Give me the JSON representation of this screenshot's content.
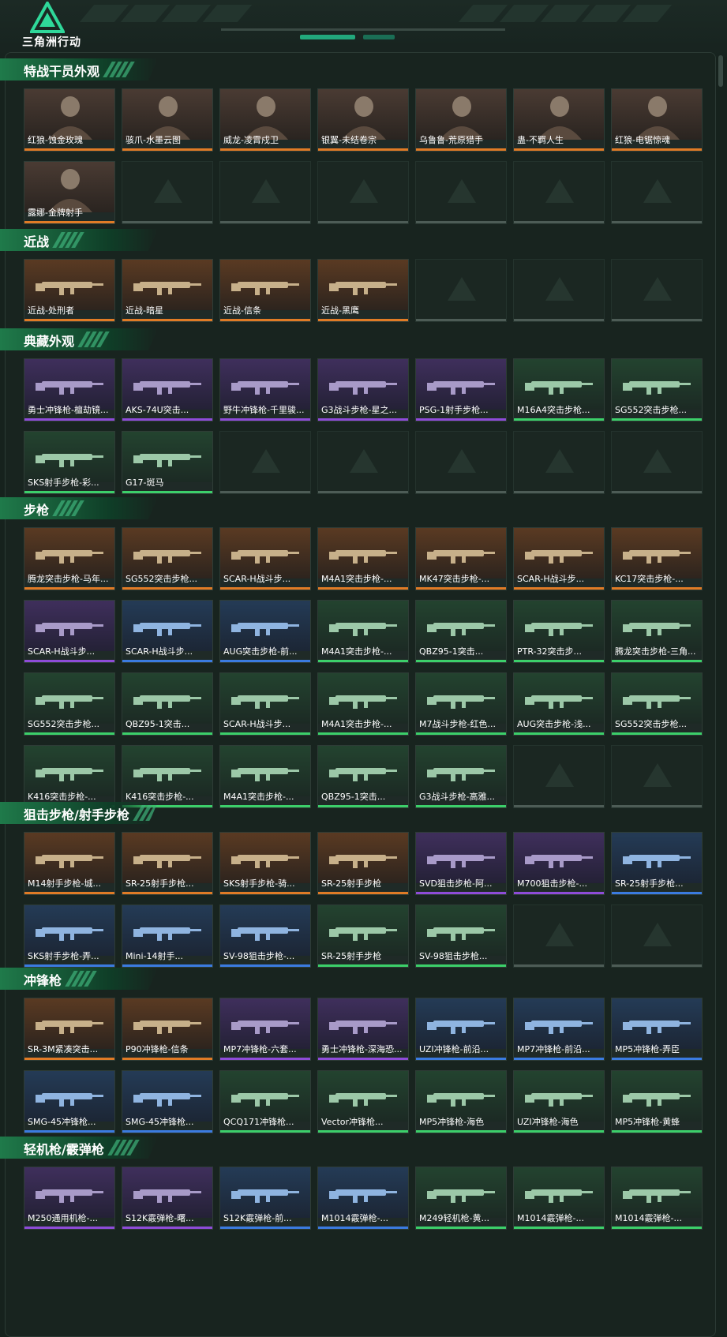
{
  "header": {
    "logo_text": "三角洲行动"
  },
  "sections": [
    {
      "title": "特战干员外观",
      "rows": [
        [
          {
            "label": "红狼-蚀金玫瑰",
            "rarity": "gold"
          },
          {
            "label": "骇爪-水墨云图",
            "rarity": "gold"
          },
          {
            "label": "威龙-凌霄戍卫",
            "rarity": "gold"
          },
          {
            "label": "银翼-未结卷宗",
            "rarity": "gold"
          },
          {
            "label": "乌鲁鲁-荒原猎手",
            "rarity": "gold"
          },
          {
            "label": "蛊-不羁人生",
            "rarity": "gold"
          },
          {
            "label": "红狼-电锯惊魂",
            "rarity": "gold"
          }
        ],
        [
          {
            "label": "露娜-金牌射手",
            "rarity": "gold"
          },
          null,
          null,
          null,
          null,
          null,
          null
        ]
      ]
    },
    {
      "title": "近战",
      "rows": [
        [
          {
            "label": "近战-处刑者",
            "rarity": "gold"
          },
          {
            "label": "近战-暗星",
            "rarity": "gold"
          },
          {
            "label": "近战-信条",
            "rarity": "gold"
          },
          {
            "label": "近战-黑鹰",
            "rarity": "gold"
          },
          null,
          null,
          null
        ]
      ]
    },
    {
      "title": "典藏外观",
      "rows": [
        [
          {
            "label": "勇士冲锋枪-檀劫镜...",
            "rarity": "purple"
          },
          {
            "label": "AKS-74U突击...",
            "rarity": "purple"
          },
          {
            "label": "野牛冲锋枪-千里骏...",
            "rarity": "purple"
          },
          {
            "label": "G3战斗步枪-星之...",
            "rarity": "purple"
          },
          {
            "label": "PSG-1射手步枪...",
            "rarity": "purple"
          },
          {
            "label": "M16A4突击步枪...",
            "rarity": "green"
          },
          {
            "label": "SG552突击步枪...",
            "rarity": "green"
          }
        ],
        [
          {
            "label": "SKS射手步枪-彩...",
            "rarity": "green"
          },
          {
            "label": "G17-斑马",
            "rarity": "green"
          },
          null,
          null,
          null,
          null,
          null
        ]
      ]
    },
    {
      "title": "步枪",
      "rows": [
        [
          {
            "label": "腾龙突击步枪-马年...",
            "rarity": "gold"
          },
          {
            "label": "SG552突击步枪...",
            "rarity": "gold"
          },
          {
            "label": "SCAR-H战斗步...",
            "rarity": "gold"
          },
          {
            "label": "M4A1突击步枪-...",
            "rarity": "gold"
          },
          {
            "label": "MK47突击步枪-...",
            "rarity": "gold"
          },
          {
            "label": "SCAR-H战斗步...",
            "rarity": "gold"
          },
          {
            "label": "KC17突击步枪-...",
            "rarity": "gold"
          }
        ],
        [
          {
            "label": "SCAR-H战斗步...",
            "rarity": "purple"
          },
          {
            "label": "SCAR-H战斗步...",
            "rarity": "blue"
          },
          {
            "label": "AUG突击步枪-前...",
            "rarity": "blue"
          },
          {
            "label": "M4A1突击步枪-...",
            "rarity": "green"
          },
          {
            "label": "QBZ95-1突击...",
            "rarity": "green"
          },
          {
            "label": "PTR-32突击步...",
            "rarity": "green"
          },
          {
            "label": "腾龙突击步枪-三角...",
            "rarity": "green"
          }
        ],
        [
          {
            "label": "SG552突击步枪...",
            "rarity": "green"
          },
          {
            "label": "QBZ95-1突击...",
            "rarity": "green"
          },
          {
            "label": "SCAR-H战斗步...",
            "rarity": "green"
          },
          {
            "label": "M4A1突击步枪-...",
            "rarity": "green"
          },
          {
            "label": "M7战斗步枪-红色...",
            "rarity": "green"
          },
          {
            "label": "AUG突击步枪-浅...",
            "rarity": "green"
          },
          {
            "label": "SG552突击步枪...",
            "rarity": "green"
          }
        ],
        [
          {
            "label": "K416突击步枪-...",
            "rarity": "green"
          },
          {
            "label": "K416突击步枪-...",
            "rarity": "green"
          },
          {
            "label": "M4A1突击步枪-...",
            "rarity": "green"
          },
          {
            "label": "QBZ95-1突击...",
            "rarity": "green"
          },
          {
            "label": "G3战斗步枪-高雅...",
            "rarity": "green"
          },
          null,
          null
        ]
      ]
    },
    {
      "title": "狙击步枪/射手步枪",
      "rows": [
        [
          {
            "label": "M14射手步枪-城...",
            "rarity": "gold"
          },
          {
            "label": "SR-25射手步枪...",
            "rarity": "gold"
          },
          {
            "label": "SKS射手步枪-骑...",
            "rarity": "gold"
          },
          {
            "label": "SR-25射手步枪",
            "rarity": "gold"
          },
          {
            "label": "SVD狙击步枪-阿...",
            "rarity": "purple"
          },
          {
            "label": "M700狙击步枪-...",
            "rarity": "purple"
          },
          {
            "label": "SR-25射手步枪...",
            "rarity": "blue"
          }
        ],
        [
          {
            "label": "SKS射手步枪-弄...",
            "rarity": "blue"
          },
          {
            "label": "Mini-14射手...",
            "rarity": "blue"
          },
          {
            "label": "SV-98狙击步枪-...",
            "rarity": "blue"
          },
          {
            "label": "SR-25射手步枪",
            "rarity": "green"
          },
          {
            "label": "SV-98狙击步枪...",
            "rarity": "green"
          },
          null,
          null
        ]
      ]
    },
    {
      "title": "冲锋枪",
      "rows": [
        [
          {
            "label": "SR-3M紧凑突击...",
            "rarity": "gold"
          },
          {
            "label": "P90冲锋枪-信条",
            "rarity": "gold"
          },
          {
            "label": "MP7冲锋枪-六套...",
            "rarity": "purple"
          },
          {
            "label": "勇士冲锋枪-深海恐...",
            "rarity": "purple"
          },
          {
            "label": "UZI冲锋枪-前沿...",
            "rarity": "blue"
          },
          {
            "label": "MP7冲锋枪-前沿...",
            "rarity": "blue"
          },
          {
            "label": "MP5冲锋枪-弄臣",
            "rarity": "blue"
          }
        ],
        [
          {
            "label": "SMG-45冲锋枪...",
            "rarity": "blue"
          },
          {
            "label": "SMG-45冲锋枪...",
            "rarity": "blue"
          },
          {
            "label": "QCQ171冲锋枪...",
            "rarity": "green"
          },
          {
            "label": "Vector冲锋枪...",
            "rarity": "green"
          },
          {
            "label": "MP5冲锋枪-海色",
            "rarity": "green"
          },
          {
            "label": "UZI冲锋枪-海色",
            "rarity": "green"
          },
          {
            "label": "MP5冲锋枪-黄蜂",
            "rarity": "green"
          }
        ]
      ]
    },
    {
      "title": "轻机枪/霰弹枪",
      "rows": [
        [
          {
            "label": "M250通用机枪-...",
            "rarity": "purple"
          },
          {
            "label": "S12K霰弹枪-曙...",
            "rarity": "purple"
          },
          {
            "label": "S12K霰弹枪-前...",
            "rarity": "blue"
          },
          {
            "label": "M1014霰弹枪-...",
            "rarity": "blue"
          },
          {
            "label": "M249轻机枪-黄...",
            "rarity": "green"
          },
          {
            "label": "M1014霰弹枪-...",
            "rarity": "green"
          },
          {
            "label": "M1014霰弹枪-...",
            "rarity": "green"
          }
        ]
      ]
    }
  ]
}
